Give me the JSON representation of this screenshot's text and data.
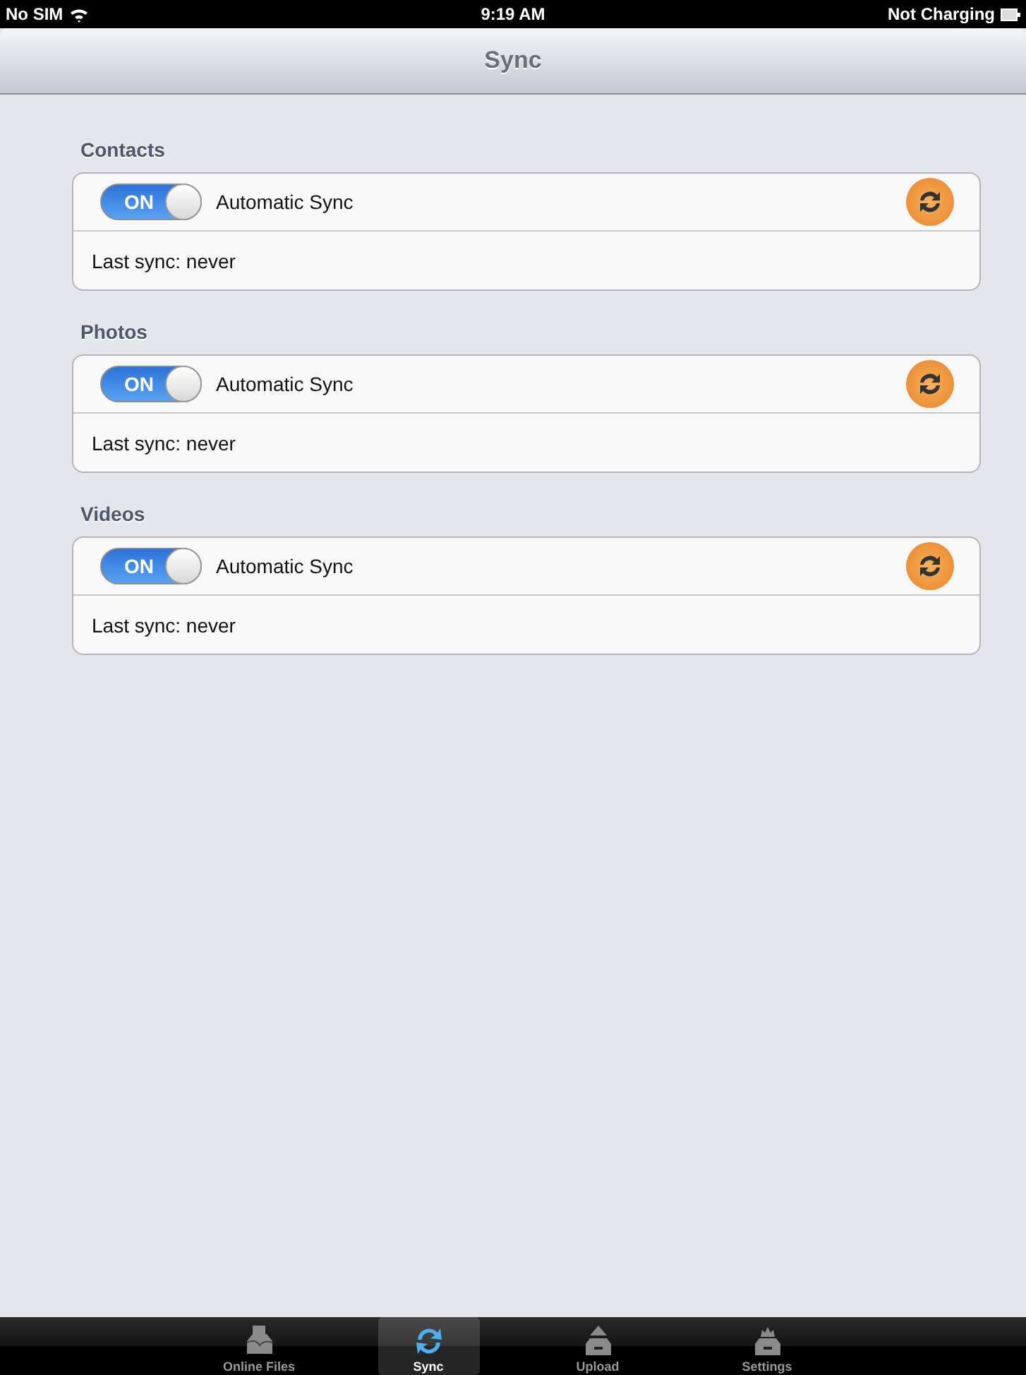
{
  "status_bar": {
    "carrier": "No SIM",
    "time": "9:19 AM",
    "battery": "Not Charging"
  },
  "nav_bar": {
    "title": "Sync"
  },
  "sections": [
    {
      "title": "Contacts",
      "toggle_label": "ON",
      "on": true,
      "label": "Automatic Sync",
      "last_sync": "Last sync: never"
    },
    {
      "title": "Photos",
      "toggle_label": "ON",
      "on": true,
      "label": "Automatic Sync",
      "last_sync": "Last sync: never"
    },
    {
      "title": "Videos",
      "toggle_label": "ON",
      "on": true,
      "label": "Automatic Sync",
      "last_sync": "Last sync: never"
    }
  ],
  "tab_bar": [
    {
      "label": "Online Files",
      "kind": "files",
      "selected": false
    },
    {
      "label": "Sync",
      "kind": "sync",
      "selected": true
    },
    {
      "label": "Upload",
      "kind": "upload",
      "selected": false
    },
    {
      "label": "Settings",
      "kind": "settings",
      "selected": false
    }
  ]
}
